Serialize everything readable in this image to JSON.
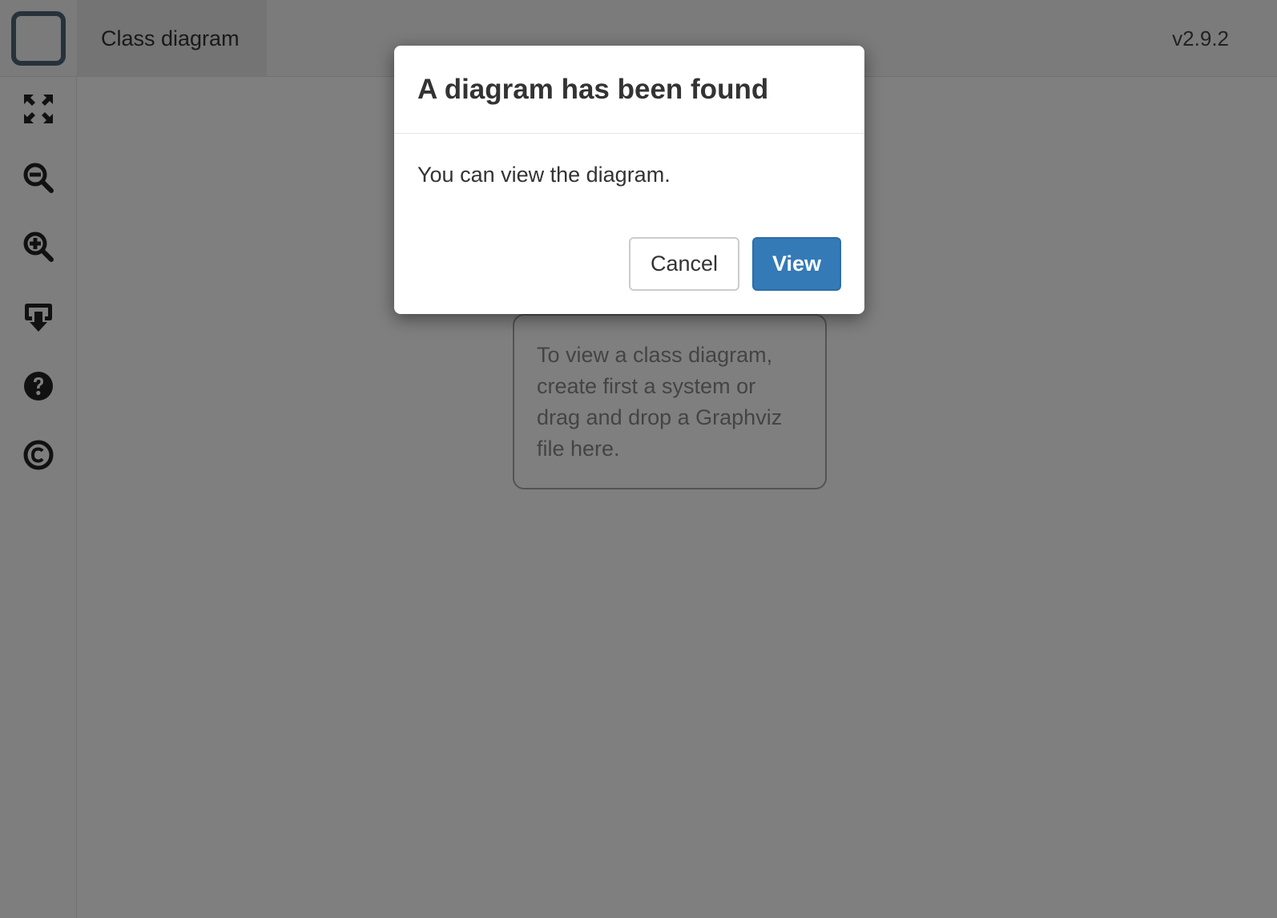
{
  "header": {
    "title": "Class diagram",
    "version": "v2.9.2"
  },
  "sidebar": {
    "tools": [
      {
        "icon": "expand-arrows-icon"
      },
      {
        "icon": "zoom-out-icon"
      },
      {
        "icon": "zoom-in-icon"
      },
      {
        "icon": "download-icon"
      },
      {
        "icon": "help-icon"
      },
      {
        "icon": "copyright-icon"
      }
    ]
  },
  "canvas": {
    "hint": "To view a class diagram, create first a system or drag and drop a Graphviz file here."
  },
  "modal": {
    "title": "A diagram has been found",
    "body": "You can view the diagram.",
    "cancel_label": "Cancel",
    "view_label": "View"
  },
  "colors": {
    "primary": "#337ab7",
    "logo": "#4d6674",
    "overlay": "rgba(0,0,0,0.5)"
  }
}
